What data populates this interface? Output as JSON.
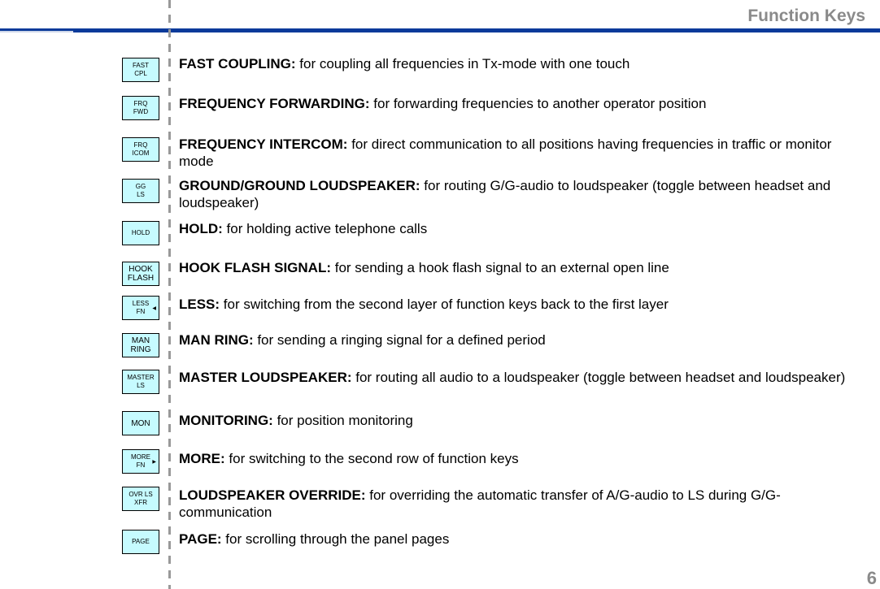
{
  "header": {
    "title": "Function Keys"
  },
  "page_number": "6",
  "colors": {
    "rule": "#0a3a9a",
    "key_fill": "#c6fbff",
    "title_gray": "#8a8a8a"
  },
  "items": [
    {
      "key": "FAST\nCPL",
      "name": "FAST COUPLING:",
      "text": " for coupling all frequencies in Tx-mode with one touch"
    },
    {
      "key": "FRQ\nFWD",
      "name": "FREQUENCY FORWARDING:",
      "text": " for forwarding frequencies to another operator position"
    },
    {
      "key": "FRQ\nICOM",
      "name": "FREQUENCY INTERCOM:",
      "text": " for direct communication to all positions having frequencies in traffic or monitor mode"
    },
    {
      "key": "GG\nLS",
      "name": "GROUND/GROUND LOUDSPEAKER:",
      "text": " for routing G/G-audio to loudspeaker (toggle between headset and loudspeaker)"
    },
    {
      "key": "HOLD",
      "name": "HOLD:",
      "text": " for holding active telephone calls"
    },
    {
      "key": "HOOK\nFLASH",
      "name": "HOOK FLASH SIGNAL:",
      "text": " for sending a hook flash signal to an external open line"
    },
    {
      "key": "LESS\nFN",
      "arrow": "◀",
      "name": "LESS:",
      "text": " for switching from the second layer of function keys back to the first layer"
    },
    {
      "key": "MAN\nRING",
      "name": "MAN RING:",
      "text": " for sending a ringing signal for a defined period"
    },
    {
      "key": "MASTER\nLS",
      "name": "MASTER LOUDSPEAKER:",
      "text": " for routing all audio to a loudspeaker (toggle between headset and loudspeaker)"
    },
    {
      "key": "MON",
      "name": "MONITORING:",
      "text": " for position monitoring"
    },
    {
      "key": "MORE\nFN",
      "arrow": "▶",
      "name": "MORE:",
      "text": " for switching to the second row of function keys"
    },
    {
      "key": "OVR LS\nXFR",
      "name": "LOUDSPEAKER OVERRIDE:",
      "text": " for overriding the automatic transfer of A/G-audio to LS during G/G-communication"
    },
    {
      "key": "PAGE",
      "name": "PAGE:",
      "text": " for scrolling through the panel pages"
    }
  ]
}
